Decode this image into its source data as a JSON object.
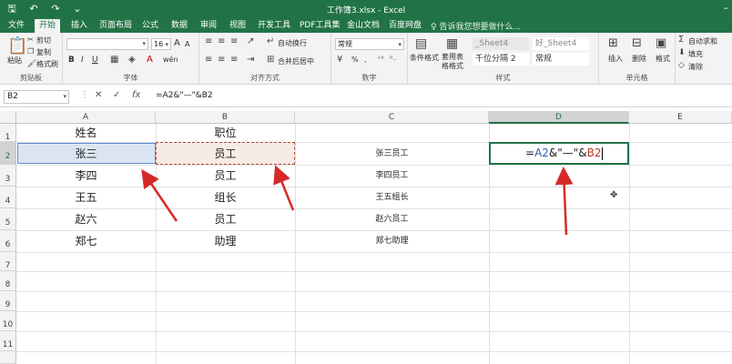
{
  "window": {
    "title": "工作簿3.xlsx - Excel",
    "qat_icons": [
      "save-icon",
      "undo-icon",
      "redo-icon",
      "customize-icon"
    ]
  },
  "tabs": [
    {
      "label": "文件"
    },
    {
      "label": "开始"
    },
    {
      "label": "插入"
    },
    {
      "label": "页面布局"
    },
    {
      "label": "公式"
    },
    {
      "label": "数据"
    },
    {
      "label": "审阅"
    },
    {
      "label": "视图"
    },
    {
      "label": "开发工具"
    },
    {
      "label": "PDF工具集"
    },
    {
      "label": "金山文档"
    },
    {
      "label": "百度网盘"
    }
  ],
  "active_tab": "开始",
  "tell_me": "告诉我您想要做什么...",
  "ribbon": {
    "clipboard": {
      "paste": "粘贴",
      "cut": "剪切",
      "copy": "复制",
      "format_painter": "格式刷",
      "label": "剪贴板"
    },
    "font": {
      "label": "字体",
      "size": "16",
      "bold": "B",
      "italic": "I",
      "underline": "U",
      "grow": "A",
      "shrink": "A",
      "color": "A",
      "wen": "wén"
    },
    "align": {
      "label": "对齐方式",
      "wrap": "自动换行",
      "merge": "合并后居中"
    },
    "number": {
      "label": "数字",
      "format": "常规",
      "percent": "%",
      "comma": ","
    },
    "styles": {
      "label": "样式",
      "cond_format": "条件格式",
      "table_format": "套用表格格式",
      "cells": [
        "_Sheet4",
        "好_Sheet4",
        "千位分隔 2",
        "常规"
      ]
    },
    "cells": {
      "label": "单元格",
      "insert": "插入",
      "delete": "删除",
      "format": "格式"
    },
    "editing": {
      "autosum": "自动求和",
      "fill": "填充",
      "clear": "清除"
    }
  },
  "formula_bar": {
    "name_box": "B2",
    "cancel": "✕",
    "enter": "✓",
    "fx": "fx",
    "formula": "=A2&\"—\"&B2"
  },
  "columns": [
    "A",
    "B",
    "C",
    "D",
    "E"
  ],
  "rows": [
    "1",
    "2",
    "3",
    "4",
    "5",
    "6",
    "7",
    "8",
    "9",
    "10",
    "11"
  ],
  "cells": {
    "A1": "姓名",
    "B1": "职位",
    "A2": "张三",
    "B2": "员工",
    "C2": "张三员工",
    "A3": "李四",
    "B3": "员工",
    "C3": "李四员工",
    "A4": "王五",
    "B4": "组长",
    "C4": "王五组长",
    "A5": "赵六",
    "B5": "员工",
    "C5": "赵六员工",
    "A6": "郑七",
    "B6": "助理",
    "C6": "郑七助理"
  },
  "editing_cell": {
    "address": "D2",
    "parts": {
      "eq": "=",
      "ref_a": "A2",
      "op1": "&\"—\"&",
      "ref_b": "B2"
    },
    "ref_colors": {
      "a": "#2f5da8",
      "b": "#c0392b"
    }
  },
  "accent": "#217346",
  "annotation_color": "#d62a2a"
}
